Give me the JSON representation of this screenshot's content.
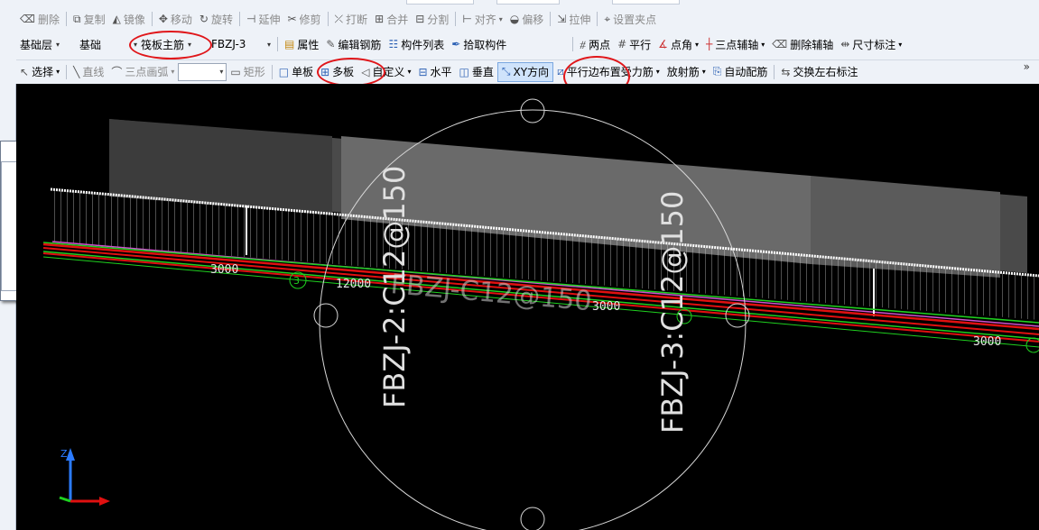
{
  "toolbar_row1": {
    "delete": "删除",
    "copy": "复制",
    "mirror": "镜像",
    "move": "移动",
    "rotate": "旋转",
    "extend": "延伸",
    "trim": "修剪",
    "break": "打断",
    "merge": "合并",
    "split": "分割",
    "align": "对齐",
    "offset": "偏移",
    "stretch": "拉伸",
    "set_grip": "设置夹点"
  },
  "toolbar_row2": {
    "layer": "基础层",
    "category": "基础",
    "element_type": "筏板主筋",
    "element_name": "FBZJ-3",
    "properties": "属性",
    "edit_rebar": "编辑钢筋",
    "component_list": "构件列表",
    "pick_component": "拾取构件",
    "two_points": "两点",
    "parallel": "平行",
    "point_angle": "点角",
    "three_point_axis": "三点辅轴",
    "delete_axis": "删除辅轴",
    "dimension": "尺寸标注"
  },
  "toolbar_row3": {
    "select": "选择",
    "line": "直线",
    "three_point_arc": "三点画弧",
    "rectangle": "矩形",
    "single_slab": "单板",
    "multi_slab": "多板",
    "custom": "自定义",
    "horizontal": "水平",
    "vertical": "垂直",
    "xy_direction": "XY方向",
    "parallel_edge": "平行边布置受力筋",
    "radial": "放射筋",
    "auto_rebar": "自动配筋",
    "swap_labels": "交换左右标注",
    "more": "»"
  },
  "canvas": {
    "labels": {
      "rebar_left": "FBZJ-2:C12@150",
      "rebar_right": "FBZJ-3:C12@150",
      "rebar_mid": "FBZJ-C12@150",
      "dim_1": "3000",
      "dim_2": "12000",
      "dim_3": "3000",
      "dim_4": "3000",
      "axis_num": "3"
    },
    "axis_z": "Z"
  },
  "colors": {
    "toolbar_bg": "#eef2f8",
    "canvas_bg": "#000000",
    "highlight_red": "#e0161a",
    "green_line": "#1fd11f",
    "red_line": "#e01010",
    "magenta_line": "#d050d0"
  }
}
